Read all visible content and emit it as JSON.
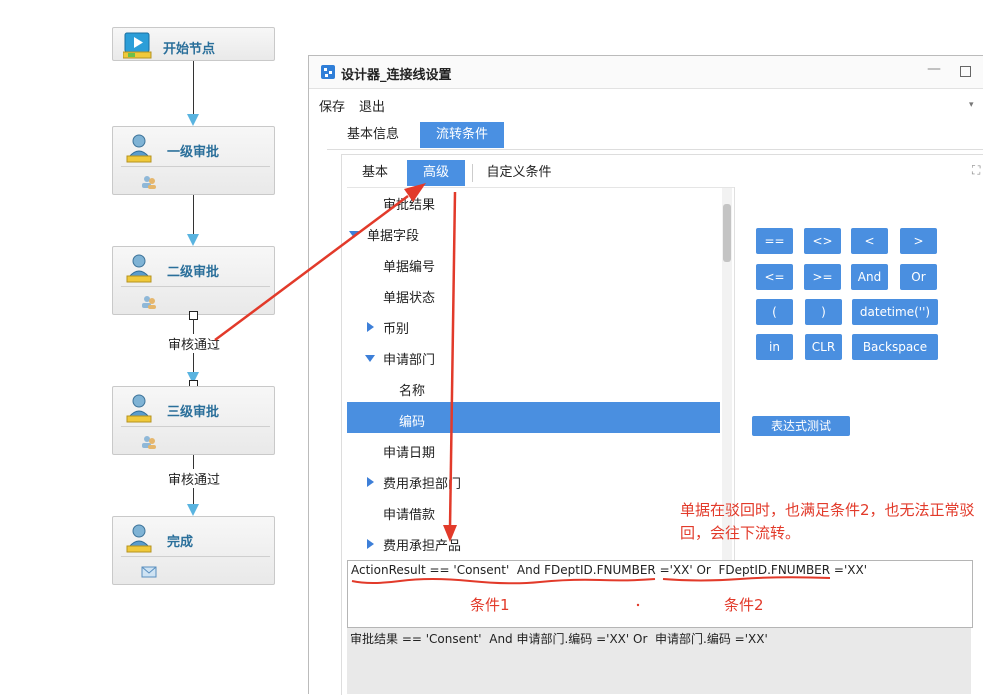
{
  "flow": {
    "nodes": [
      {
        "label": "开始节点",
        "icon": "play-icon"
      },
      {
        "label": "一级审批",
        "icon": "user-icon"
      },
      {
        "label": "二级审批",
        "icon": "user-icon"
      },
      {
        "label": "三级审批",
        "icon": "user-icon"
      },
      {
        "label": "完成",
        "icon": "user-icon"
      }
    ],
    "edge_labels": [
      "审核通过",
      "审核通过"
    ]
  },
  "dialog": {
    "title": "设计器_连接线设置",
    "menu": [
      "保存",
      "退出"
    ],
    "outer_tabs": [
      "基本信息",
      "流转条件"
    ],
    "outer_tab_active": 1,
    "inner_tabs": [
      "基本",
      "高级",
      "自定义条件"
    ],
    "inner_tab_active": 1,
    "tree": [
      {
        "label": "审批结果",
        "level": 1,
        "expander": "none"
      },
      {
        "label": "单据字段",
        "level": 0,
        "expander": "down"
      },
      {
        "label": "单据编号",
        "level": 1,
        "expander": "none"
      },
      {
        "label": "单据状态",
        "level": 1,
        "expander": "none"
      },
      {
        "label": "币别",
        "level": 1,
        "expander": "right"
      },
      {
        "label": "申请部门",
        "level": 1,
        "expander": "down"
      },
      {
        "label": "名称",
        "level": 2,
        "expander": "none"
      },
      {
        "label": "编码",
        "level": 2,
        "expander": "none",
        "selected": true
      },
      {
        "label": "申请日期",
        "level": 1,
        "expander": "none"
      },
      {
        "label": "费用承担部门",
        "level": 1,
        "expander": "right"
      },
      {
        "label": "申请借款",
        "level": 1,
        "expander": "none"
      },
      {
        "label": "费用承担产品",
        "level": 1,
        "expander": "right"
      }
    ],
    "operators": [
      [
        "==",
        "<>",
        "<",
        ">"
      ],
      [
        "<=",
        ">=",
        "And",
        "Or"
      ],
      [
        "(",
        ")",
        "datetime('')"
      ],
      [
        "in",
        "CLR",
        "Backspace"
      ]
    ],
    "test_button": "表达式测试",
    "expression": "ActionResult == 'Consent'  And FDeptID.FNUMBER ='XX' Or  FDeptID.FNUMBER ='XX'",
    "expression_display": "审批结果 == 'Consent'  And 申请部门.编码 ='XX' Or  申请部门.编码 ='XX'"
  },
  "annotations": {
    "note": "单据在驳回时，也满足条件2，也无法正常驳回，会往下流转。",
    "cond1": "条件1",
    "cond2": "条件2",
    "colors": {
      "red": "#e23a2a",
      "blue": "#4a8fe0"
    }
  }
}
